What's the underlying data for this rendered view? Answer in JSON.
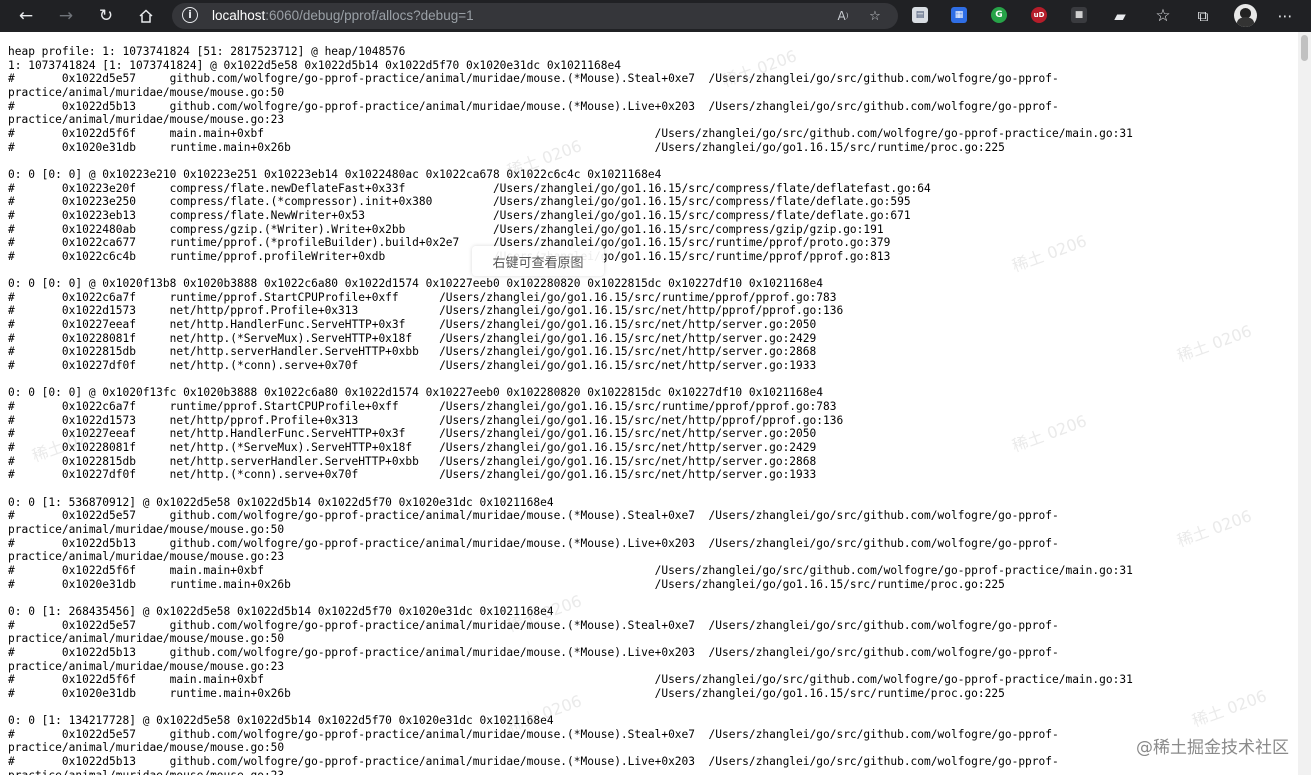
{
  "browser": {
    "url_host": "localhost",
    "url_path": ":6060/debug/pprof/allocs?debug=1",
    "icons": [
      "back-arrow-icon",
      "forward-arrow-icon",
      "reload-icon",
      "home-icon",
      "info-icon",
      "read-aloud-icon",
      "add-favorite-icon",
      "extension-icons",
      "extensions-puzzle-icon",
      "favorites-star-icon",
      "collections-icon",
      "profile-avatar",
      "more-menu-icon"
    ]
  },
  "profile_lines": [
    "heap profile: 1: 1073741824 [51: 2817523712] @ heap/1048576",
    "1: 1073741824 [1: 1073741824] @ 0x1022d5e58 0x1022d5b14 0x1022d5f70 0x1020e31dc 0x1021168e4",
    "#\t0x1022d5e57\tgithub.com/wolfogre/go-pprof-practice/animal/muridae/mouse.(*Mouse).Steal+0xe7\t/Users/zhanglei/go/src/github.com/wolfogre/go-pprof-",
    "practice/animal/muridae/mouse/mouse.go:50",
    "#\t0x1022d5b13\tgithub.com/wolfogre/go-pprof-practice/animal/muridae/mouse.(*Mouse).Live+0x203\t/Users/zhanglei/go/src/github.com/wolfogre/go-pprof-",
    "practice/animal/muridae/mouse/mouse.go:23",
    "#\t0x1022d5f6f\tmain.main+0xbf\t\t\t\t\t\t\t\t/Users/zhanglei/go/src/github.com/wolfogre/go-pprof-practice/main.go:31",
    "#\t0x1020e31db\truntime.main+0x26b\t\t\t\t\t\t\t/Users/zhanglei/go/go1.16.15/src/runtime/proc.go:225",
    "",
    "0: 0 [0: 0] @ 0x10223e210 0x10223e251 0x10223eb14 0x1022480ac 0x1022ca678 0x1022c6c4c 0x1021168e4",
    "#\t0x10223e20f\tcompress/flate.newDeflateFast+0x33f\t\t/Users/zhanglei/go/go1.16.15/src/compress/flate/deflatefast.go:64",
    "#\t0x10223e250\tcompress/flate.(*compressor).init+0x380\t\t/Users/zhanglei/go/go1.16.15/src/compress/flate/deflate.go:595",
    "#\t0x10223eb13\tcompress/flate.NewWriter+0x53\t\t\t/Users/zhanglei/go/go1.16.15/src/compress/flate/deflate.go:671",
    "#\t0x1022480ab\tcompress/gzip.(*Writer).Write+0x2bb\t\t/Users/zhanglei/go/go1.16.15/src/compress/gzip/gzip.go:191",
    "#\t0x1022ca677\truntime/pprof.(*profileBuilder).build+0x2e7\t/Users/zhanglei/go/go1.16.15/src/runtime/pprof/proto.go:379",
    "#\t0x1022c6c4b\truntime/pprof.profileWriter+0xdb\t\t/Users/zhanglei/go/go1.16.15/src/runtime/pprof/pprof.go:813",
    "",
    "0: 0 [0: 0] @ 0x1020f13b8 0x1020b3888 0x1022c6a80 0x1022d1574 0x10227eeb0 0x102280820 0x1022815dc 0x10227df10 0x1021168e4",
    "#\t0x1022c6a7f\truntime/pprof.StartCPUProfile+0xff\t/Users/zhanglei/go/go1.16.15/src/runtime/pprof/pprof.go:783",
    "#\t0x1022d1573\tnet/http/pprof.Profile+0x313\t\t/Users/zhanglei/go/go1.16.15/src/net/http/pprof/pprof.go:136",
    "#\t0x10227eeaf\tnet/http.HandlerFunc.ServeHTTP+0x3f\t/Users/zhanglei/go/go1.16.15/src/net/http/server.go:2050",
    "#\t0x10228081f\tnet/http.(*ServeMux).ServeHTTP+0x18f\t/Users/zhanglei/go/go1.16.15/src/net/http/server.go:2429",
    "#\t0x1022815db\tnet/http.serverHandler.ServeHTTP+0xbb\t/Users/zhanglei/go/go1.16.15/src/net/http/server.go:2868",
    "#\t0x10227df0f\tnet/http.(*conn).serve+0x70f\t\t/Users/zhanglei/go/go1.16.15/src/net/http/server.go:1933",
    "",
    "0: 0 [0: 0] @ 0x1020f13fc 0x1020b3888 0x1022c6a80 0x1022d1574 0x10227eeb0 0x102280820 0x1022815dc 0x10227df10 0x1021168e4",
    "#\t0x1022c6a7f\truntime/pprof.StartCPUProfile+0xff\t/Users/zhanglei/go/go1.16.15/src/runtime/pprof/pprof.go:783",
    "#\t0x1022d1573\tnet/http/pprof.Profile+0x313\t\t/Users/zhanglei/go/go1.16.15/src/net/http/pprof/pprof.go:136",
    "#\t0x10227eeaf\tnet/http.HandlerFunc.ServeHTTP+0x3f\t/Users/zhanglei/go/go1.16.15/src/net/http/server.go:2050",
    "#\t0x10228081f\tnet/http.(*ServeMux).ServeHTTP+0x18f\t/Users/zhanglei/go/go1.16.15/src/net/http/server.go:2429",
    "#\t0x1022815db\tnet/http.serverHandler.ServeHTTP+0xbb\t/Users/zhanglei/go/go1.16.15/src/net/http/server.go:2868",
    "#\t0x10227df0f\tnet/http.(*conn).serve+0x70f\t\t/Users/zhanglei/go/go1.16.15/src/net/http/server.go:1933",
    "",
    "0: 0 [1: 536870912] @ 0x1022d5e58 0x1022d5b14 0x1022d5f70 0x1020e31dc 0x1021168e4",
    "#\t0x1022d5e57\tgithub.com/wolfogre/go-pprof-practice/animal/muridae/mouse.(*Mouse).Steal+0xe7\t/Users/zhanglei/go/src/github.com/wolfogre/go-pprof-",
    "practice/animal/muridae/mouse/mouse.go:50",
    "#\t0x1022d5b13\tgithub.com/wolfogre/go-pprof-practice/animal/muridae/mouse.(*Mouse).Live+0x203\t/Users/zhanglei/go/src/github.com/wolfogre/go-pprof-",
    "practice/animal/muridae/mouse/mouse.go:23",
    "#\t0x1022d5f6f\tmain.main+0xbf\t\t\t\t\t\t\t\t/Users/zhanglei/go/src/github.com/wolfogre/go-pprof-practice/main.go:31",
    "#\t0x1020e31db\truntime.main+0x26b\t\t\t\t\t\t\t/Users/zhanglei/go/go1.16.15/src/runtime/proc.go:225",
    "",
    "0: 0 [1: 268435456] @ 0x1022d5e58 0x1022d5b14 0x1022d5f70 0x1020e31dc 0x1021168e4",
    "#\t0x1022d5e57\tgithub.com/wolfogre/go-pprof-practice/animal/muridae/mouse.(*Mouse).Steal+0xe7\t/Users/zhanglei/go/src/github.com/wolfogre/go-pprof-",
    "practice/animal/muridae/mouse/mouse.go:50",
    "#\t0x1022d5b13\tgithub.com/wolfogre/go-pprof-practice/animal/muridae/mouse.(*Mouse).Live+0x203\t/Users/zhanglei/go/src/github.com/wolfogre/go-pprof-",
    "practice/animal/muridae/mouse/mouse.go:23",
    "#\t0x1022d5f6f\tmain.main+0xbf\t\t\t\t\t\t\t\t/Users/zhanglei/go/src/github.com/wolfogre/go-pprof-practice/main.go:31",
    "#\t0x1020e31db\truntime.main+0x26b\t\t\t\t\t\t\t/Users/zhanglei/go/go1.16.15/src/runtime/proc.go:225",
    "",
    "0: 0 [1: 134217728] @ 0x1022d5e58 0x1022d5b14 0x1022d5f70 0x1020e31dc 0x1021168e4",
    "#\t0x1022d5e57\tgithub.com/wolfogre/go-pprof-practice/animal/muridae/mouse.(*Mouse).Steal+0xe7\t/Users/zhanglei/go/src/github.com/wolfogre/go-pprof-",
    "practice/animal/muridae/mouse/mouse.go:50",
    "#\t0x1022d5b13\tgithub.com/wolfogre/go-pprof-practice/animal/muridae/mouse.(*Mouse).Live+0x203\t/Users/zhanglei/go/src/github.com/wolfogre/go-pprof-",
    "practice/animal/muridae/mouse/mouse.go:23"
  ],
  "overlay": {
    "tooltip": "右键可查看原图",
    "watermark": "稀土 0206",
    "site_mark": "@稀土掘金技术社区"
  }
}
